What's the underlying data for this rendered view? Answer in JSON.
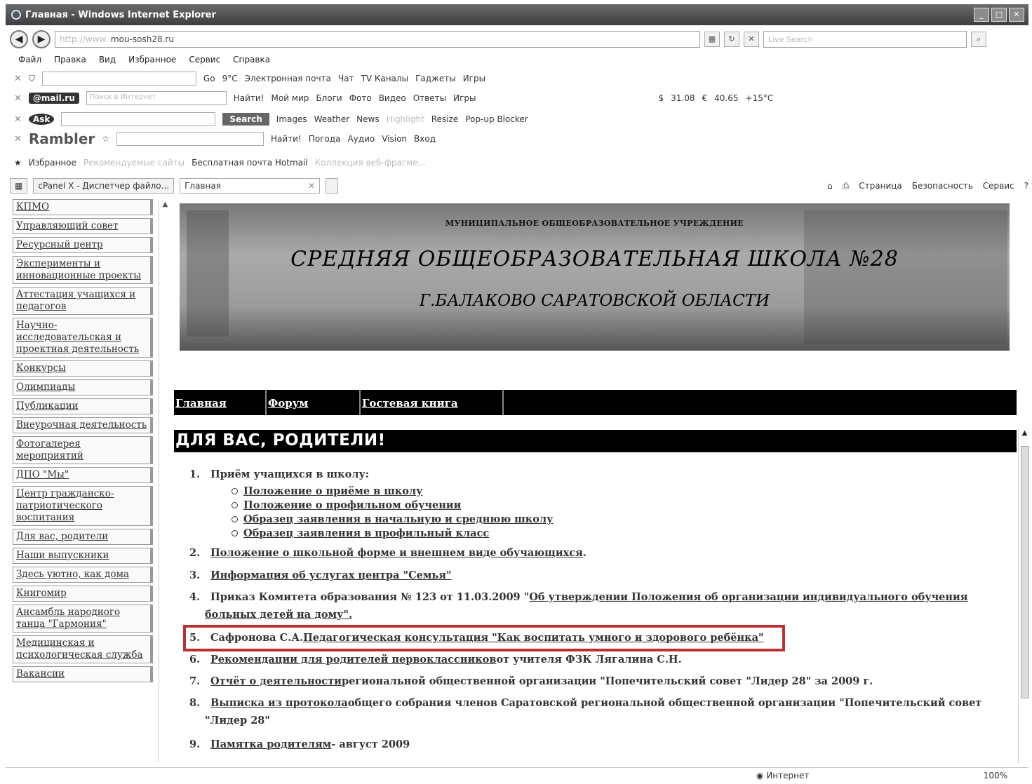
{
  "window": {
    "title": "Главная - Windows Internet Explorer"
  },
  "address": {
    "prefix": "http://www.",
    "url": "mou-sosh28.ru",
    "search_placeholder": "Live Search"
  },
  "menu": [
    "Файл",
    "Правка",
    "Вид",
    "Избранное",
    "Сервис",
    "Справка"
  ],
  "toolbar1": {
    "go": "Go",
    "temp": "9°C",
    "email": "Электронная почта",
    "chat": "Чат",
    "tv": "TV Каналы",
    "gadgets": "Гаджеты",
    "games": "Игры"
  },
  "toolbar2": {
    "brand": "@mail.ru",
    "placeholder": "Поиск в Интернет",
    "find": "Найти!",
    "myworld": "Мой мир",
    "blogs": "Блоги",
    "photo": "Фото",
    "video": "Видео",
    "answers": "Ответы",
    "games": "Игры",
    "usd": "31.08",
    "eur": "40.65",
    "weather": "+15°C"
  },
  "toolbar3": {
    "brand": "Ask",
    "search": "Search",
    "images": "Images",
    "weather": "Weather",
    "news": "News",
    "highlight": "Highlight",
    "resize": "Resize",
    "popup": "Pop-up Blocker"
  },
  "toolbar4": {
    "brand": "Rambler",
    "find": "Найти!",
    "weather": "Погода",
    "audio": "Аудио",
    "vision": "Vision",
    "login": "Вход"
  },
  "favorites": {
    "label": "Избранное",
    "suggested": "Рекомендуемые сайты",
    "hotmail": "Бесплатная почта Hotmail",
    "webslices": "Коллекция веб-фрагме..."
  },
  "tabs": {
    "tab1": "cPanel X - Диспетчер файло...",
    "tab2": "Главная",
    "page": "Страница",
    "safety": "Безопасность",
    "service": "Сервис"
  },
  "sidebar": [
    "КПМО",
    "Управляющий совет",
    "Ресурсный центр",
    "Эксперименты и инновационные проекты",
    "Аттестация учащихся и педагогов",
    "Научно-исследовательская и проектная деятельность",
    "Конкурсы",
    "Олимпиады",
    "Публикации",
    "Внеурочная деятельность",
    "Фотогалерея мероприятий",
    "ДПО \"Мы\"",
    "Центр гражданско-патриотического воспитания",
    "Для вас, родители",
    "Наши выпускники",
    "Здесь уютно, как дома",
    "Книгомир",
    "Ансамбль народного танца \"Гармония\"",
    "Медицинская и психологическая служба",
    "Вакансии"
  ],
  "banner": {
    "line1": "МУНИЦИПАЛЬНОЕ ОБЩЕОБРАЗОВАТЕЛЬНОЕ УЧРЕЖДЕНИЕ",
    "line2": "СРЕДНЯЯ ОБЩЕОБРАЗОВАТЕЛЬНАЯ ШКОЛА №28",
    "line3": "Г.БАЛАКОВО САРАТОВСКОЙ ОБЛАСТИ"
  },
  "nav": [
    "Главная",
    "Форум",
    "Гостевая книга"
  ],
  "heading": "ДЛЯ ВАС, РОДИТЕЛИ!",
  "items": {
    "i1": {
      "num": "1.",
      "text": "Приём учащихся в школу:"
    },
    "sub": [
      "Положение о приёме в школу",
      "Положение о профильном обучении",
      "Образец заявления в начальную и среднюю школу",
      "Образец заявления в профильный класс"
    ],
    "i2": {
      "num": "2.",
      "link": "Положение о школьной форме и внешнем виде обучающихся",
      "rest": "."
    },
    "i3": {
      "num": "3.",
      "link": "Информация об услугах центра \"Семья\""
    },
    "i4": {
      "num": "4.",
      "text": "Приказ Комитета образования № 123 от 11.03.2009 \"",
      "link": "Об утверждении Положения об организации индивидуального обучения",
      "link2": "больных детей на дому\"."
    },
    "i5": {
      "num": "5.",
      "text": "Сафронова С.А. ",
      "link": "Педагогическая консультация \"Как воспитать умного и здорового ребёнка\""
    },
    "i6": {
      "num": "6.",
      "link": "Рекомендации для родителей первоклассников",
      "rest": " от учителя ФЗК Лягалина С.Н."
    },
    "i7": {
      "num": "7.",
      "link": "Отчёт о деятельности",
      "rest": " региональной общественной организации \"Попечительский совет \"Лидер 28\" за 2009 г."
    },
    "i8": {
      "num": "8.",
      "link": "Выписка из протокола",
      "rest": " общего собрания членов Саратовской региональной общественной организации \"Попечительский совет",
      "rest2": "\"Лидер 28\""
    },
    "i9": {
      "num": "9.",
      "link": "Памятка родителям",
      "rest": " - август 2009"
    }
  },
  "status": {
    "zone": "Интернет",
    "zoom": "100%"
  }
}
